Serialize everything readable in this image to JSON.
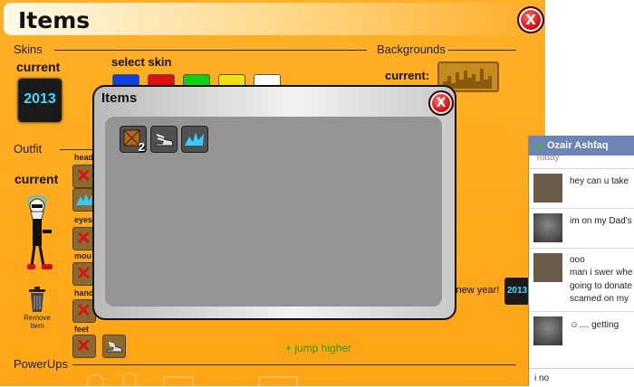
{
  "window": {
    "title": "Items",
    "close_label": "X"
  },
  "sections": {
    "skins": "Skins",
    "backgrounds": "Backgrounds",
    "outfit": "Outfit",
    "powerups": "PowerUps"
  },
  "skins": {
    "current_label": "current",
    "current_value": "2013",
    "select_label": "select skin",
    "swatches": [
      {
        "name": "blue",
        "color": "#1040e0"
      },
      {
        "name": "red",
        "color": "#e01010"
      },
      {
        "name": "green",
        "color": "#10d010"
      },
      {
        "name": "yellow",
        "color": "#f0e010"
      },
      {
        "name": "white",
        "color": "#ffffff"
      }
    ]
  },
  "backgrounds": {
    "current_label": "current:"
  },
  "outfit": {
    "current_label": "current",
    "slots": {
      "head": "head",
      "eyes": "eyes",
      "mouth": "mou",
      "hands": "hand",
      "feet": "feet"
    },
    "remove_item": "Remove Item"
  },
  "powerup_text": "+ jump higher",
  "new_year_text": "y new year!",
  "new_year_badge": "2013",
  "modal": {
    "title": "Items",
    "close_label": "X",
    "items": [
      {
        "icon": "crate-icon",
        "count": "2"
      },
      {
        "icon": "winged-shoe-icon"
      },
      {
        "icon": "cyan-spark-icon"
      }
    ]
  },
  "chat": {
    "name": "Ozair Ashfaq",
    "status_color": "#42b72a",
    "day": "Today",
    "messages": [
      {
        "lines": [
          "hey can u take"
        ]
      },
      {
        "lines": [
          "im on my Dad's"
        ]
      },
      {
        "lines": [
          "ooo",
          "man i swer whe",
          "going to donate",
          "scamed on my"
        ]
      },
      {
        "lines": [
          "☺.... getting"
        ]
      }
    ],
    "input_value": "i no"
  },
  "colors": {
    "panel": "#ffa515",
    "chat_header": "#6d84b4",
    "modal_close": "#d00000"
  }
}
